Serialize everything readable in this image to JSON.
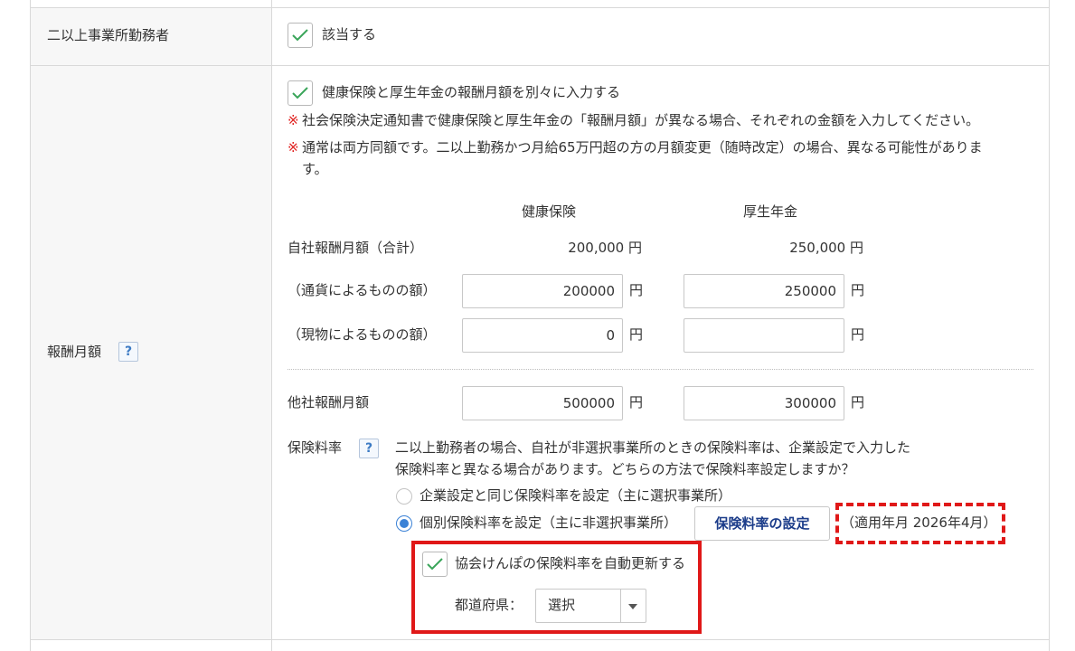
{
  "row1": {
    "label": "二以上事業所勤務者",
    "checkbox_label": "該当する"
  },
  "row2": {
    "label": "報酬月額",
    "help_icon": "?",
    "separate_checkbox_label": "健康保険と厚生年金の報酬月額を別々に入力する",
    "notes": [
      {
        "mark": "※",
        "text": "社会保険決定通知書で健康保険と厚生年金の「報酬月額」が異なる場合、それぞれの金額を入力してください。"
      },
      {
        "mark": "※",
        "text_line1": "通常は両方同額です。二以上勤務かつ月給65万円超の方の月額変更（随時改定）の場合、異なる可能性がありま",
        "text_line2": "す。"
      }
    ],
    "columns": {
      "health": "健康保険",
      "pension": "厚生年金"
    },
    "own_total": {
      "label": "自社報酬月額（合計）",
      "health": "200,000 円",
      "pension": "250,000 円"
    },
    "currency": {
      "label": "（通貨によるものの額）",
      "health": "200000",
      "pension": "250000",
      "unit": "円"
    },
    "in_kind": {
      "label": "（現物によるものの額）",
      "health": "0",
      "pension": "",
      "unit": "円"
    },
    "other_company": {
      "label": "他社報酬月額",
      "health": "500000",
      "pension": "300000",
      "unit": "円"
    },
    "rate": {
      "label": "保険料率",
      "help_icon": "?",
      "desc_line1": "二以上勤務者の場合、自社が非選択事業所のときの保険料率は、企業設定で入力した",
      "desc_line2": "保険料率と異なる場合があります。どちらの方法で保険料率設定しますか？",
      "option1": "企業設定と同じ保険料率を設定（主に選択事業所）",
      "option2": "個別保険料率を設定（主に非選択事業所）",
      "selected": "option2",
      "settings_button": "保険料率の設定",
      "applied": "（適用年月 2026年4月）",
      "auto_update_label": "協会けんぽの保険料率を自動更新する",
      "prefecture_label": "都道府県：",
      "prefecture_value": "選択"
    }
  },
  "colors": {
    "accent": "#3b82d6",
    "note_red": "#e0201e",
    "highlight_red": "#e01818",
    "check_green": "#3aa55a",
    "button_text": "#1c3d8a"
  }
}
